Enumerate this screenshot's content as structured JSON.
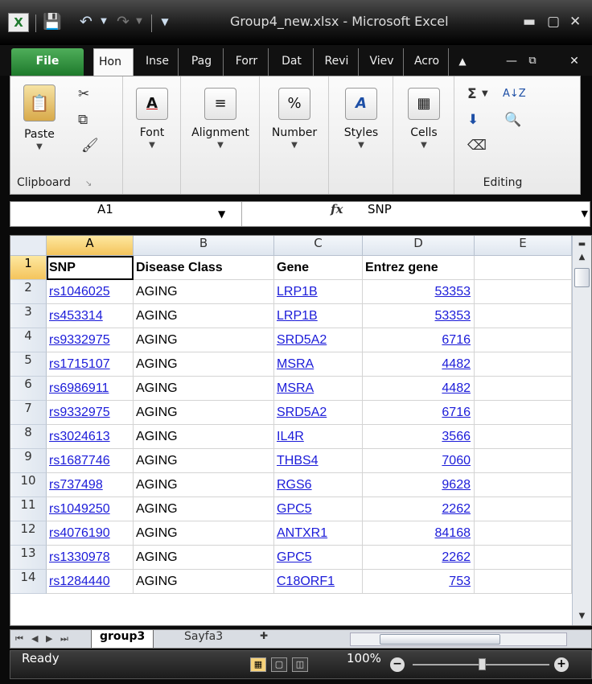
{
  "window": {
    "title": "Group4_new.xlsx - Microsoft Excel",
    "app_icon": "X",
    "minimize": "▬",
    "maximize": "▢",
    "close": "✕"
  },
  "ribbon_tabs": [
    "Hon",
    "Inse",
    "Pag",
    "Forr",
    "Dat",
    "Revi",
    "Viev",
    "Acro"
  ],
  "file_tab": "File",
  "ribbon": {
    "paste": "Paste",
    "clipboard_group": "Clipboard",
    "font": "Font",
    "alignment": "Alignment",
    "number": "Number",
    "styles": "Styles",
    "cells": "Cells",
    "editing_group": "Editing",
    "percent_icon": "%",
    "font_icon": "A",
    "sum_icon": "Σ",
    "sort_icon": "A↓Z"
  },
  "formula_bar": {
    "name_box": "A1",
    "fx": "fx",
    "value": "SNP"
  },
  "columns": [
    "A",
    "B",
    "C",
    "D",
    "E"
  ],
  "rows": [
    {
      "n": "1",
      "a": "SNP",
      "b": "Disease Class",
      "c": "Gene",
      "d": "Entrez gene"
    },
    {
      "n": "2",
      "a": "rs1046025",
      "b": "AGING",
      "c": "LRP1B",
      "d": "53353"
    },
    {
      "n": "3",
      "a": "rs453314",
      "b": "AGING",
      "c": "LRP1B",
      "d": "53353"
    },
    {
      "n": "4",
      "a": "rs9332975",
      "b": "AGING",
      "c": "SRD5A2",
      "d": "6716"
    },
    {
      "n": "5",
      "a": "rs1715107",
      "b": "AGING",
      "c": "MSRA",
      "d": "4482"
    },
    {
      "n": "6",
      "a": "rs6986911",
      "b": "AGING",
      "c": "MSRA",
      "d": "4482"
    },
    {
      "n": "7",
      "a": "rs9332975",
      "b": "AGING",
      "c": "SRD5A2",
      "d": "6716"
    },
    {
      "n": "8",
      "a": "rs3024613",
      "b": "AGING",
      "c": "IL4R",
      "d": "3566"
    },
    {
      "n": "9",
      "a": "rs1687746",
      "b": "AGING",
      "c": "THBS4",
      "d": "7060"
    },
    {
      "n": "10",
      "a": "rs737498",
      "b": "AGING",
      "c": "RGS6",
      "d": "9628"
    },
    {
      "n": "11",
      "a": "rs1049250",
      "b": "AGING",
      "c": "GPC5",
      "d": "2262"
    },
    {
      "n": "12",
      "a": "rs4076190",
      "b": "AGING",
      "c": "ANTXR1",
      "d": "84168"
    },
    {
      "n": "13",
      "a": "rs1330978",
      "b": "AGING",
      "c": "GPC5",
      "d": "2262"
    },
    {
      "n": "14",
      "a": "rs1284440",
      "b": "AGING",
      "c": "C18ORF1",
      "d": "753"
    }
  ],
  "sheets": [
    "group3",
    "Sayfa3"
  ],
  "status": {
    "ready": "Ready",
    "zoom": "100%"
  },
  "colors": {
    "link": "#1b1bd9",
    "selected_header": "#f4c45c",
    "file_tab": "#1e7a2c"
  }
}
